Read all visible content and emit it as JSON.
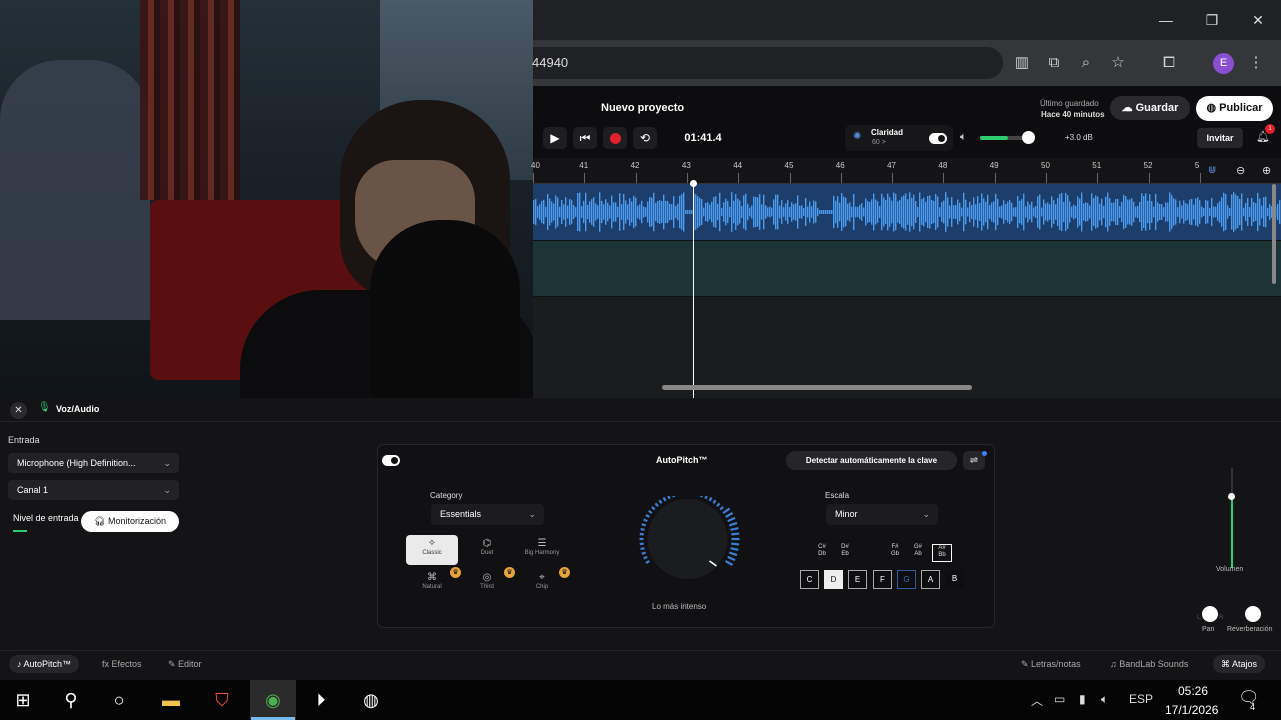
{
  "browser": {
    "url_fragment": "44940",
    "profile_initial": "E"
  },
  "header": {
    "project_title": "Nuevo proyecto",
    "saved_label": "Último guardado",
    "saved_value": "Hace 40 minutos",
    "save_label": "Guardar",
    "publish_label": "Publicar",
    "time": "01:41.4",
    "claridad_label": "Claridad",
    "claridad_value": "60 >",
    "gain": "+3.0 dB",
    "invite_label": "Invitar",
    "notif_count": "1"
  },
  "ruler": [
    "40",
    "41",
    "42",
    "43",
    "44",
    "45",
    "46",
    "47",
    "48",
    "49",
    "50",
    "51",
    "52",
    "5"
  ],
  "panel": {
    "title": "Voz/Audio",
    "entrada_label": "Entrada",
    "input_device": "Microphone (High Definition...",
    "channel": "Canal 1",
    "nivel_label": "Nivel de entrada",
    "monitor_label": "Monitorización"
  },
  "autopitch": {
    "title": "AutoPitch™",
    "detect_label": "Detectar automáticamente la clave",
    "category_label": "Category",
    "category_value": "Essentials",
    "presets": [
      {
        "name": "Classic",
        "icon": "✧"
      },
      {
        "name": "Duet",
        "icon": "⌬"
      },
      {
        "name": "Big Harmony",
        "icon": "☰"
      },
      {
        "name": "Natural",
        "icon": "⌘"
      },
      {
        "name": "Third",
        "icon": "◎"
      },
      {
        "name": "Chip",
        "icon": "⌖"
      }
    ],
    "knob_label": "Lo más intenso",
    "scale_label": "Escala",
    "scale_value": "Minor",
    "sharps": [
      {
        "top": "C#",
        "bottom": "Db"
      },
      {
        "top": "D#",
        "bottom": "Eb"
      },
      {
        "top": "F#",
        "bottom": "Gb"
      },
      {
        "top": "G#",
        "bottom": "Ab"
      },
      {
        "top": "A#",
        "bottom": "Bb"
      }
    ],
    "keys": [
      "C",
      "D",
      "E",
      "F",
      "G",
      "A",
      "B"
    ]
  },
  "right": {
    "volume_label": "Volumen",
    "pan_label": "Pan",
    "reverb_label": "Reverberación",
    "lr_left": "L",
    "lr_right": "R"
  },
  "bottom_tabs": {
    "autopitch": "AutoPitch™",
    "effects": "Efectos",
    "editor": "Editor",
    "lyrics": "Letras/notas",
    "sounds": "BandLab Sounds",
    "shortcuts": "Atajos"
  },
  "taskbar": {
    "lang": "ESP",
    "time": "05:26",
    "date": "17/1/2026",
    "notif_count": "4"
  }
}
